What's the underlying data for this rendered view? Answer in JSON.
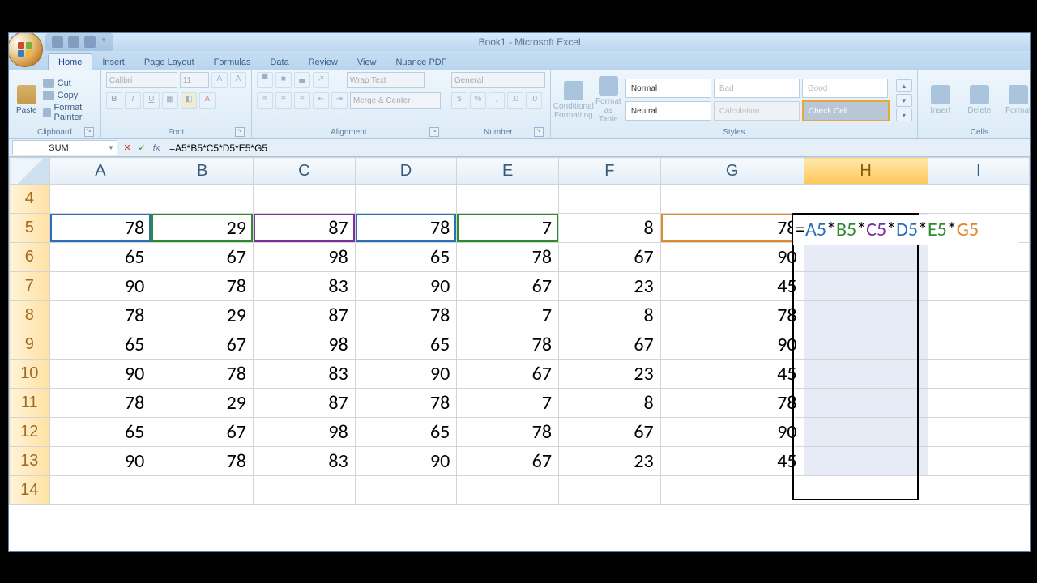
{
  "title": "Book1 - Microsoft Excel",
  "tabs": [
    "Home",
    "Insert",
    "Page Layout",
    "Formulas",
    "Data",
    "Review",
    "View",
    "Nuance PDF"
  ],
  "active_tab": 0,
  "ribbon": {
    "clipboard": {
      "label": "Clipboard",
      "paste": "Paste",
      "cut": "Cut",
      "copy": "Copy",
      "fp": "Format Painter"
    },
    "font": {
      "label": "Font",
      "name": "Calibri",
      "size": "11"
    },
    "alignment": {
      "label": "Alignment",
      "wrap": "Wrap Text",
      "merge": "Merge & Center"
    },
    "number": {
      "label": "Number",
      "format": "General"
    },
    "styles": {
      "label": "Styles",
      "cond": "Conditional Formatting",
      "table": "Format as Table",
      "cells": [
        "Normal",
        "Bad",
        "Good",
        "Neutral",
        "Calculation",
        "Check Cell"
      ]
    },
    "cells": {
      "label": "Cells",
      "insert": "Insert",
      "delete": "Delete",
      "format": "Format"
    }
  },
  "namebox": "SUM",
  "formula": "=A5*B5*C5*D5*E5*G5",
  "columns": [
    "A",
    "B",
    "C",
    "D",
    "E",
    "F",
    "G",
    "H",
    "I"
  ],
  "active_col_index": 7,
  "rows": [
    4,
    5,
    6,
    7,
    8,
    9,
    10,
    11,
    12,
    13,
    14
  ],
  "data": {
    "5": [
      78,
      29,
      87,
      78,
      7,
      8,
      78
    ],
    "6": [
      65,
      67,
      98,
      65,
      78,
      67,
      90
    ],
    "7": [
      90,
      78,
      83,
      90,
      67,
      23,
      45
    ],
    "8": [
      78,
      29,
      87,
      78,
      7,
      8,
      78
    ],
    "9": [
      65,
      67,
      98,
      65,
      78,
      67,
      90
    ],
    "10": [
      90,
      78,
      83,
      90,
      67,
      23,
      45
    ],
    "11": [
      78,
      29,
      87,
      78,
      7,
      8,
      78
    ],
    "12": [
      65,
      67,
      98,
      65,
      78,
      67,
      90
    ],
    "13": [
      90,
      78,
      83,
      90,
      67,
      23,
      45
    ]
  },
  "ref_colors": {
    "A5": "#2b6fba",
    "B5": "#2e8b2e",
    "C5": "#7b2fa0",
    "D5": "#2b6fba",
    "E5": "#2e8b2e",
    "G5": "#e08a2e"
  },
  "edit_cell": {
    "row": 5,
    "col": "H"
  },
  "edit_tokens": [
    {
      "t": "=",
      "c": "#000"
    },
    {
      "t": "A5",
      "c": "#2b6fba"
    },
    {
      "t": "*",
      "c": "#000"
    },
    {
      "t": "B5",
      "c": "#2e8b2e"
    },
    {
      "t": "*",
      "c": "#000"
    },
    {
      "t": "C5",
      "c": "#7b2fa0"
    },
    {
      "t": "*",
      "c": "#000"
    },
    {
      "t": "D5",
      "c": "#2b6fba"
    },
    {
      "t": "*",
      "c": "#000"
    },
    {
      "t": "E5",
      "c": "#2e8b2e"
    },
    {
      "t": "*",
      "c": "#000"
    },
    {
      "t": "G5",
      "c": "#e08a2e"
    }
  ],
  "sel_range": {
    "col": "H",
    "row_start": 5,
    "row_end": 13
  },
  "chart_data": {
    "type": "table",
    "columns": [
      "A",
      "B",
      "C",
      "D",
      "E",
      "F",
      "G"
    ],
    "rows": [
      "5",
      "6",
      "7",
      "8",
      "9",
      "10",
      "11",
      "12",
      "13"
    ],
    "values": [
      [
        78,
        29,
        87,
        78,
        7,
        8,
        78
      ],
      [
        65,
        67,
        98,
        65,
        78,
        67,
        90
      ],
      [
        90,
        78,
        83,
        90,
        67,
        23,
        45
      ],
      [
        78,
        29,
        87,
        78,
        7,
        8,
        78
      ],
      [
        65,
        67,
        98,
        65,
        78,
        67,
        90
      ],
      [
        90,
        78,
        83,
        90,
        67,
        23,
        45
      ],
      [
        78,
        29,
        87,
        78,
        7,
        8,
        78
      ],
      [
        65,
        67,
        98,
        65,
        78,
        67,
        90
      ],
      [
        90,
        78,
        83,
        90,
        67,
        23,
        45
      ]
    ],
    "formula_H5": "=A5*B5*C5*D5*E5*G5"
  }
}
